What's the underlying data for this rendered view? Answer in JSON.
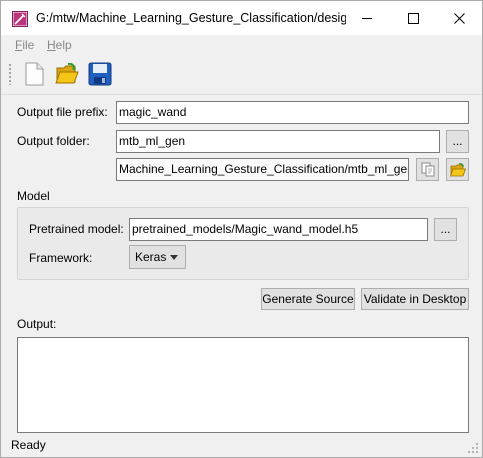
{
  "window": {
    "title": "G:/mtw/Machine_Learning_Gesture_Classification/desig..."
  },
  "menu": {
    "file": {
      "underline": "F",
      "rest": "ile"
    },
    "help": {
      "underline": "H",
      "rest": "elp"
    }
  },
  "toolbar": {
    "icons": [
      "new-file-icon",
      "open-folder-icon",
      "save-icon"
    ]
  },
  "form": {
    "prefix_label": "Output file prefix:",
    "prefix_value": "magic_wand",
    "folder_label": "Output folder:",
    "folder_value": "mtb_ml_gen",
    "browse_label": "...",
    "resolved_path": "Machine_Learning_Gesture_Classification/mtb_ml_gen"
  },
  "model": {
    "section_label": "Model",
    "pretrained_label": "Pretrained model:",
    "pretrained_value": "pretrained_models/Magic_wand_model.h5",
    "browse_label": "...",
    "framework_label": "Framework:",
    "framework_value": "Keras"
  },
  "actions": {
    "generate": "Generate Source",
    "validate": "Validate in Desktop"
  },
  "output": {
    "label": "Output:",
    "content": ""
  },
  "status": {
    "text": "Ready"
  },
  "colors": {
    "window_bg": "#f0f0f0",
    "folder_yellow": "#f5c518",
    "save_blue": "#1f5fbf"
  }
}
